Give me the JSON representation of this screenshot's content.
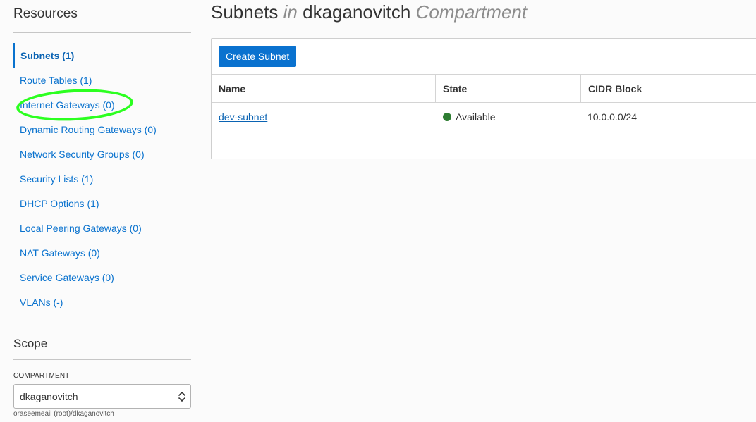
{
  "sidebar": {
    "resources_title": "Resources",
    "items": [
      {
        "label": "Subnets (1)",
        "active": true
      },
      {
        "label": "Route Tables (1)"
      },
      {
        "label": "Internet Gateways (0)"
      },
      {
        "label": "Dynamic Routing Gateways (0)"
      },
      {
        "label": "Network Security Groups (0)"
      },
      {
        "label": "Security Lists (1)"
      },
      {
        "label": "DHCP Options (1)"
      },
      {
        "label": "Local Peering Gateways (0)"
      },
      {
        "label": "NAT Gateways (0)"
      },
      {
        "label": "Service Gateways (0)"
      },
      {
        "label": "VLANs (-)"
      }
    ],
    "scope_title": "Scope",
    "compartment_label": "COMPARTMENT",
    "compartment_value": "dkaganovitch",
    "compartment_path": "oraseemeail (root)/dkaganovitch"
  },
  "main": {
    "title": {
      "prefix": "Subnets",
      "in": "in",
      "name": "dkaganovitch",
      "suffix": "Compartment"
    },
    "create_button": "Create Subnet",
    "table": {
      "headers": [
        "Name",
        "State",
        "CIDR Block"
      ],
      "rows": [
        {
          "name": "dev-subnet",
          "state": "Available",
          "cidr": "10.0.0.0/24"
        }
      ]
    }
  },
  "colors": {
    "link": "#0972ce",
    "primary_button": "#0a72cf",
    "status_available": "#2e7d32",
    "highlight": "#2cff20"
  },
  "icons": {
    "select_chevron": "chevron-up-down-icon",
    "status": "status-dot-icon"
  }
}
